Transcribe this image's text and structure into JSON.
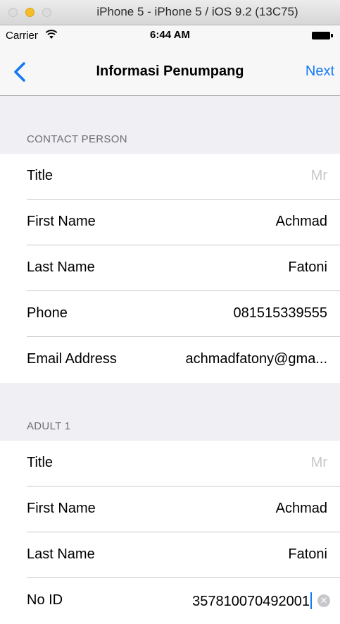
{
  "window": {
    "title": "iPhone 5 - iPhone 5 / iOS 9.2 (13C75)"
  },
  "status_bar": {
    "carrier": "Carrier",
    "time": "6:44 AM"
  },
  "nav": {
    "title": "Informasi Penumpang",
    "next_label": "Next"
  },
  "sections": {
    "contact": {
      "header": "CONTACT PERSON",
      "title_label": "Title",
      "title_placeholder": "Mr",
      "first_name_label": "First Name",
      "first_name_value": "Achmad",
      "last_name_label": "Last Name",
      "last_name_value": "Fatoni",
      "phone_label": "Phone",
      "phone_value": "081515339555",
      "email_label": "Email Address",
      "email_value": "achmadfatony@gma..."
    },
    "adult1": {
      "header": "ADULT 1",
      "title_label": "Title",
      "title_placeholder": "Mr",
      "first_name_label": "First Name",
      "first_name_value": "Achmad",
      "last_name_label": "Last Name",
      "last_name_value": "Fatoni",
      "no_id_label": "No ID",
      "no_id_value": "357810070492001"
    }
  },
  "colors": {
    "accent": "#1479f5",
    "background": "#efeff4",
    "separator": "#c8c7cc",
    "minimize": "#f5bd28"
  }
}
